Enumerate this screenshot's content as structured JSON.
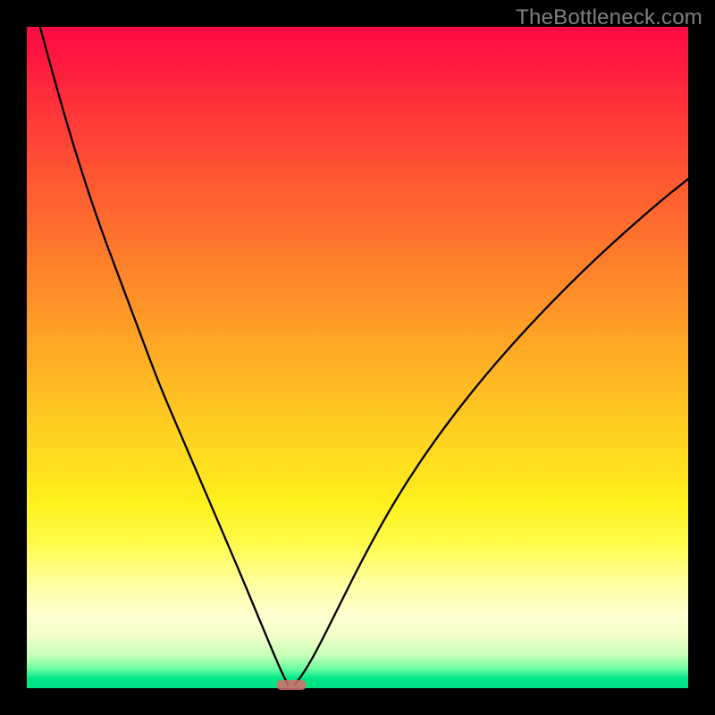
{
  "watermark": "TheBottleneck.com",
  "colors": {
    "frame": "#000000",
    "curve": "#000000",
    "marker": "#d96a6a",
    "watermark_text": "#7f7f7f"
  },
  "chart_data": {
    "type": "line",
    "title": "",
    "xlabel": "",
    "ylabel": "",
    "xlim": [
      0,
      100
    ],
    "ylim": [
      0,
      100
    ],
    "grid": false,
    "legend": false,
    "description": "Two curved branches descending from near the top edges toward a common minimum near the lower-middle-left of the plot, over a rainbow heat gradient background.",
    "series": [
      {
        "name": "left-branch",
        "x": [
          2,
          5,
          8,
          11,
          14,
          17,
          20,
          23,
          26,
          29,
          32,
          34.5,
          37,
          38.5,
          39.5
        ],
        "values": [
          100,
          89,
          79,
          70,
          62,
          54,
          46,
          39,
          32,
          25,
          18,
          12,
          6,
          2.5,
          0.5
        ]
      },
      {
        "name": "right-branch",
        "x": [
          40.5,
          42,
          44,
          47,
          51,
          56,
          62,
          69,
          77,
          86,
          95,
          100
        ],
        "values": [
          0.5,
          2.5,
          6,
          12,
          20,
          29,
          38,
          47,
          56,
          65,
          73,
          77
        ]
      }
    ],
    "marker": {
      "description": "short horizontal rounded segment at the curve minimum",
      "x_center": 40,
      "y": 0,
      "width_pct": 4.5
    },
    "background_gradient": {
      "top": "#ff0944",
      "mid_high": "#ff9a27",
      "mid": "#fef11c",
      "low_band": "#ffffd0",
      "bottom": "#00e07e"
    }
  }
}
